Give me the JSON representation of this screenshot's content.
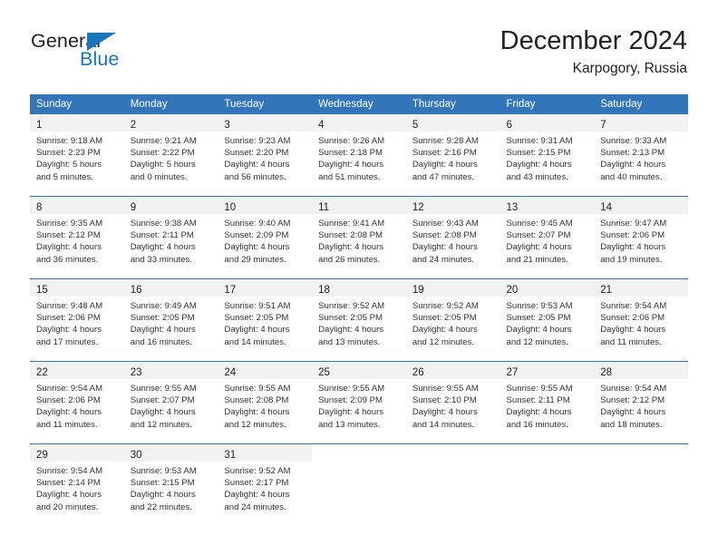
{
  "brand": {
    "name_part1": "General",
    "name_part2": "Blue",
    "accent_color": "#1b75bb"
  },
  "header": {
    "month_title": "December 2024",
    "location": "Karpogory, Russia"
  },
  "calendar": {
    "header_bg": "#3275b8",
    "daynum_band_bg": "#f2f2f2",
    "weekday_headers": [
      "Sunday",
      "Monday",
      "Tuesday",
      "Wednesday",
      "Thursday",
      "Friday",
      "Saturday"
    ],
    "weeks": [
      [
        {
          "day": "1",
          "sunrise": "Sunrise: 9:18 AM",
          "sunset": "Sunset: 2:23 PM",
          "daylight_line1": "Daylight: 5 hours",
          "daylight_line2": "and 5 minutes."
        },
        {
          "day": "2",
          "sunrise": "Sunrise: 9:21 AM",
          "sunset": "Sunset: 2:22 PM",
          "daylight_line1": "Daylight: 5 hours",
          "daylight_line2": "and 0 minutes."
        },
        {
          "day": "3",
          "sunrise": "Sunrise: 9:23 AM",
          "sunset": "Sunset: 2:20 PM",
          "daylight_line1": "Daylight: 4 hours",
          "daylight_line2": "and 56 minutes."
        },
        {
          "day": "4",
          "sunrise": "Sunrise: 9:26 AM",
          "sunset": "Sunset: 2:18 PM",
          "daylight_line1": "Daylight: 4 hours",
          "daylight_line2": "and 51 minutes."
        },
        {
          "day": "5",
          "sunrise": "Sunrise: 9:28 AM",
          "sunset": "Sunset: 2:16 PM",
          "daylight_line1": "Daylight: 4 hours",
          "daylight_line2": "and 47 minutes."
        },
        {
          "day": "6",
          "sunrise": "Sunrise: 9:31 AM",
          "sunset": "Sunset: 2:15 PM",
          "daylight_line1": "Daylight: 4 hours",
          "daylight_line2": "and 43 minutes."
        },
        {
          "day": "7",
          "sunrise": "Sunrise: 9:33 AM",
          "sunset": "Sunset: 2:13 PM",
          "daylight_line1": "Daylight: 4 hours",
          "daylight_line2": "and 40 minutes."
        }
      ],
      [
        {
          "day": "8",
          "sunrise": "Sunrise: 9:35 AM",
          "sunset": "Sunset: 2:12 PM",
          "daylight_line1": "Daylight: 4 hours",
          "daylight_line2": "and 36 minutes."
        },
        {
          "day": "9",
          "sunrise": "Sunrise: 9:38 AM",
          "sunset": "Sunset: 2:11 PM",
          "daylight_line1": "Daylight: 4 hours",
          "daylight_line2": "and 33 minutes."
        },
        {
          "day": "10",
          "sunrise": "Sunrise: 9:40 AM",
          "sunset": "Sunset: 2:09 PM",
          "daylight_line1": "Daylight: 4 hours",
          "daylight_line2": "and 29 minutes."
        },
        {
          "day": "11",
          "sunrise": "Sunrise: 9:41 AM",
          "sunset": "Sunset: 2:08 PM",
          "daylight_line1": "Daylight: 4 hours",
          "daylight_line2": "and 26 minutes."
        },
        {
          "day": "12",
          "sunrise": "Sunrise: 9:43 AM",
          "sunset": "Sunset: 2:08 PM",
          "daylight_line1": "Daylight: 4 hours",
          "daylight_line2": "and 24 minutes."
        },
        {
          "day": "13",
          "sunrise": "Sunrise: 9:45 AM",
          "sunset": "Sunset: 2:07 PM",
          "daylight_line1": "Daylight: 4 hours",
          "daylight_line2": "and 21 minutes."
        },
        {
          "day": "14",
          "sunrise": "Sunrise: 9:47 AM",
          "sunset": "Sunset: 2:06 PM",
          "daylight_line1": "Daylight: 4 hours",
          "daylight_line2": "and 19 minutes."
        }
      ],
      [
        {
          "day": "15",
          "sunrise": "Sunrise: 9:48 AM",
          "sunset": "Sunset: 2:06 PM",
          "daylight_line1": "Daylight: 4 hours",
          "daylight_line2": "and 17 minutes."
        },
        {
          "day": "16",
          "sunrise": "Sunrise: 9:49 AM",
          "sunset": "Sunset: 2:05 PM",
          "daylight_line1": "Daylight: 4 hours",
          "daylight_line2": "and 16 minutes."
        },
        {
          "day": "17",
          "sunrise": "Sunrise: 9:51 AM",
          "sunset": "Sunset: 2:05 PM",
          "daylight_line1": "Daylight: 4 hours",
          "daylight_line2": "and 14 minutes."
        },
        {
          "day": "18",
          "sunrise": "Sunrise: 9:52 AM",
          "sunset": "Sunset: 2:05 PM",
          "daylight_line1": "Daylight: 4 hours",
          "daylight_line2": "and 13 minutes."
        },
        {
          "day": "19",
          "sunrise": "Sunrise: 9:52 AM",
          "sunset": "Sunset: 2:05 PM",
          "daylight_line1": "Daylight: 4 hours",
          "daylight_line2": "and 12 minutes."
        },
        {
          "day": "20",
          "sunrise": "Sunrise: 9:53 AM",
          "sunset": "Sunset: 2:05 PM",
          "daylight_line1": "Daylight: 4 hours",
          "daylight_line2": "and 12 minutes."
        },
        {
          "day": "21",
          "sunrise": "Sunrise: 9:54 AM",
          "sunset": "Sunset: 2:06 PM",
          "daylight_line1": "Daylight: 4 hours",
          "daylight_line2": "and 11 minutes."
        }
      ],
      [
        {
          "day": "22",
          "sunrise": "Sunrise: 9:54 AM",
          "sunset": "Sunset: 2:06 PM",
          "daylight_line1": "Daylight: 4 hours",
          "daylight_line2": "and 11 minutes."
        },
        {
          "day": "23",
          "sunrise": "Sunrise: 9:55 AM",
          "sunset": "Sunset: 2:07 PM",
          "daylight_line1": "Daylight: 4 hours",
          "daylight_line2": "and 12 minutes."
        },
        {
          "day": "24",
          "sunrise": "Sunrise: 9:55 AM",
          "sunset": "Sunset: 2:08 PM",
          "daylight_line1": "Daylight: 4 hours",
          "daylight_line2": "and 12 minutes."
        },
        {
          "day": "25",
          "sunrise": "Sunrise: 9:55 AM",
          "sunset": "Sunset: 2:09 PM",
          "daylight_line1": "Daylight: 4 hours",
          "daylight_line2": "and 13 minutes."
        },
        {
          "day": "26",
          "sunrise": "Sunrise: 9:55 AM",
          "sunset": "Sunset: 2:10 PM",
          "daylight_line1": "Daylight: 4 hours",
          "daylight_line2": "and 14 minutes."
        },
        {
          "day": "27",
          "sunrise": "Sunrise: 9:55 AM",
          "sunset": "Sunset: 2:11 PM",
          "daylight_line1": "Daylight: 4 hours",
          "daylight_line2": "and 16 minutes."
        },
        {
          "day": "28",
          "sunrise": "Sunrise: 9:54 AM",
          "sunset": "Sunset: 2:12 PM",
          "daylight_line1": "Daylight: 4 hours",
          "daylight_line2": "and 18 minutes."
        }
      ],
      [
        {
          "day": "29",
          "sunrise": "Sunrise: 9:54 AM",
          "sunset": "Sunset: 2:14 PM",
          "daylight_line1": "Daylight: 4 hours",
          "daylight_line2": "and 20 minutes."
        },
        {
          "day": "30",
          "sunrise": "Sunrise: 9:53 AM",
          "sunset": "Sunset: 2:15 PM",
          "daylight_line1": "Daylight: 4 hours",
          "daylight_line2": "and 22 minutes."
        },
        {
          "day": "31",
          "sunrise": "Sunrise: 9:52 AM",
          "sunset": "Sunset: 2:17 PM",
          "daylight_line1": "Daylight: 4 hours",
          "daylight_line2": "and 24 minutes."
        },
        {
          "day": "",
          "sunrise": "",
          "sunset": "",
          "daylight_line1": "",
          "daylight_line2": ""
        },
        {
          "day": "",
          "sunrise": "",
          "sunset": "",
          "daylight_line1": "",
          "daylight_line2": ""
        },
        {
          "day": "",
          "sunrise": "",
          "sunset": "",
          "daylight_line1": "",
          "daylight_line2": ""
        },
        {
          "day": "",
          "sunrise": "",
          "sunset": "",
          "daylight_line1": "",
          "daylight_line2": ""
        }
      ]
    ]
  }
}
